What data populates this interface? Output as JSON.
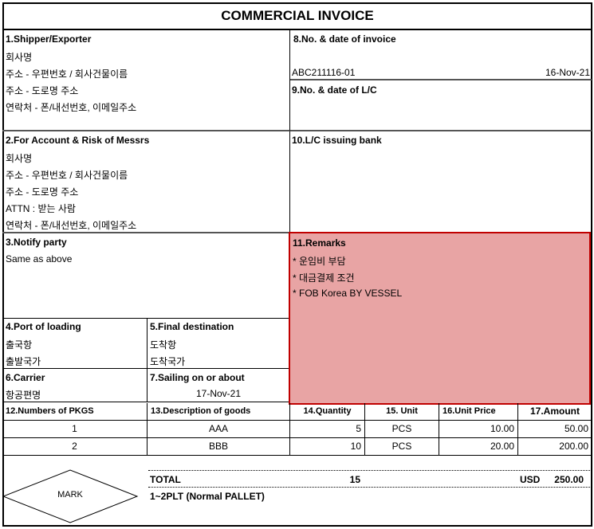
{
  "title": "COMMERCIAL INVOICE",
  "shipper": {
    "label": "1.Shipper/Exporter",
    "lines": [
      "회사명",
      "주소 - 우편번호 / 회사건물이름",
      "주소 - 도로명 주소",
      "연락처 - 폰/내선번호, 이메일주소"
    ]
  },
  "invoice": {
    "label": "8.No. & date of invoice",
    "number": "ABC211116-01",
    "date": "16-Nov-21"
  },
  "lc": {
    "label": "9.No. & date of L/C"
  },
  "account": {
    "label": "2.For Account & Risk of Messrs",
    "lines": [
      "회사명",
      "주소 - 우편번호 / 회사건물이름",
      "주소 - 도로명 주소",
      "ATTN : 받는 사람",
      "연락처 - 폰/내선번호, 이메일주소"
    ]
  },
  "bank": {
    "label": "10.L/C issuing bank"
  },
  "notify": {
    "label": "3.Notify party",
    "value": "Same as above"
  },
  "remarks": {
    "label": "11.Remarks",
    "lines": [
      "* 운임비 부담",
      "* 대금결제 조건",
      "* FOB Korea BY VESSEL"
    ]
  },
  "port": {
    "label": "4.Port of loading",
    "lines": [
      "출국항",
      "출발국가"
    ]
  },
  "destination": {
    "label": "5.Final destination",
    "lines": [
      "도착항",
      "도착국가"
    ]
  },
  "carrier": {
    "label": "6.Carrier",
    "value": "항공편명"
  },
  "sailing": {
    "label": "7.Sailing on or about",
    "value": "17-Nov-21"
  },
  "table": {
    "headers": [
      "12.Numbers of PKGS",
      "13.Description of goods",
      "14.Quantity",
      "15. Unit",
      "16.Unit Price",
      "17.Amount"
    ],
    "rows": [
      [
        "1",
        "AAA",
        "5",
        "PCS",
        "10.00",
        "50.00"
      ],
      [
        "2",
        "BBB",
        "10",
        "PCS",
        "20.00",
        "200.00"
      ]
    ]
  },
  "total": {
    "label": "TOTAL",
    "quantity": "15",
    "currency": "USD",
    "amount": "250.00",
    "packing": "1~2PLT (Normal PALLET)"
  },
  "mark": "MARK",
  "colors": {
    "highlight": "#e8a4a4",
    "highlight_border": "#c00000"
  }
}
